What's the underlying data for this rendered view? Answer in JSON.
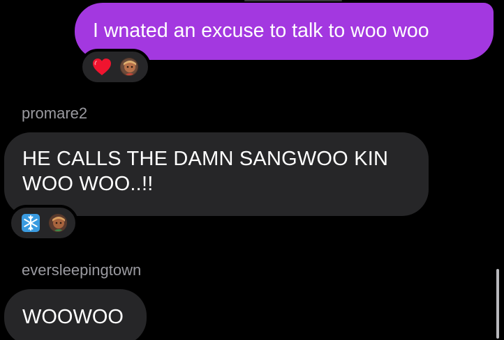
{
  "messages": [
    {
      "direction": "outgoing",
      "text": "I wnated an excuse to talk to woo woo",
      "bubble_color": "#a338e0",
      "reactions": [
        {
          "type": "emoji",
          "icon": "red-heart-icon"
        },
        {
          "type": "avatar",
          "icon": "reactor-avatar"
        }
      ]
    },
    {
      "direction": "incoming",
      "sender": "promare2",
      "text_lines": [
        "HE CALLS THE DAMN SANGWOO KIN",
        "WOO WOO..!!"
      ],
      "bubble_color": "#262628",
      "reactions": [
        {
          "type": "emoji",
          "icon": "snowflake-icon"
        },
        {
          "type": "avatar",
          "icon": "reactor-avatar"
        }
      ]
    },
    {
      "direction": "incoming",
      "sender": "eversleepingtown",
      "text": "WOOWOO",
      "bubble_color": "#262628"
    }
  ],
  "colors": {
    "background": "#000000",
    "sender_name": "#9a9aa0",
    "message_text": "#ffffff"
  }
}
